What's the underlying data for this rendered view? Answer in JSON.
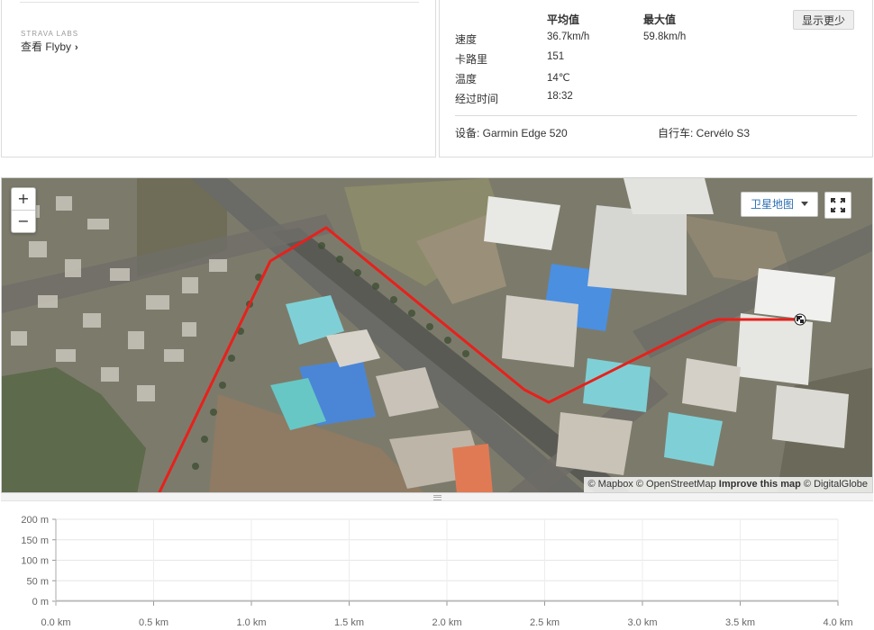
{
  "flyby": {
    "labs_tag": "STRAVA LABS",
    "link_label": "查看 Flyby",
    "chevron_icon": "chevron-right-icon"
  },
  "stats": {
    "header_avg": "平均值",
    "header_max": "最大值",
    "show_less_label": "显示更少",
    "rows": [
      {
        "label": "速度",
        "avg": "36.7km/h",
        "max": "59.8km/h"
      },
      {
        "label": "卡路里",
        "avg": "151",
        "max": ""
      },
      {
        "label": "温度",
        "avg": "14℃",
        "max": ""
      },
      {
        "label": "经过时间",
        "avg": "18:32",
        "max": ""
      }
    ],
    "device": "设备: Garmin Edge 520",
    "bike": "自行车: Cervélo S3"
  },
  "map": {
    "zoom_in_label": "+",
    "zoom_out_label": "−",
    "layer_label": "卫星地图",
    "fullscreen_icon": "fullscreen-icon",
    "end_marker_icon": "checkered-flag-icon",
    "route_color": "#e8201c",
    "attribution": {
      "mapbox": "© Mapbox",
      "osm": "© OpenStreetMap",
      "improve": "Improve this map",
      "digitalglobe": "© DigitalGlobe"
    }
  },
  "chart_data": {
    "type": "area",
    "title": "",
    "xlabel": "",
    "ylabel": "",
    "x_ticks": [
      "0.0 km",
      "0.5 km",
      "1.0 km",
      "1.5 km",
      "2.0 km",
      "2.5 km",
      "3.0 km",
      "3.5 km",
      "4.0 km"
    ],
    "y_ticks": [
      "200 m",
      "150 m",
      "100 m",
      "50 m",
      "0 m"
    ],
    "xlim": [
      0,
      4.0
    ],
    "ylim": [
      0,
      200
    ],
    "x": [
      0,
      4.0
    ],
    "series": [
      {
        "values": [
          2,
          2
        ]
      }
    ],
    "fill_color": "#dddddd",
    "grid": true
  }
}
